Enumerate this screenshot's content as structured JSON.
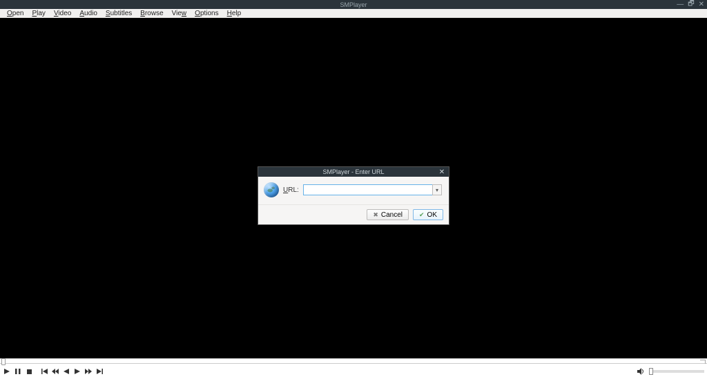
{
  "window": {
    "title": "SMPlayer"
  },
  "menu": {
    "items": [
      {
        "label": "Open",
        "mnemonic_index": 0
      },
      {
        "label": "Play",
        "mnemonic_index": 0
      },
      {
        "label": "Video",
        "mnemonic_index": 0
      },
      {
        "label": "Audio",
        "mnemonic_index": 0
      },
      {
        "label": "Subtitles",
        "mnemonic_index": 0
      },
      {
        "label": "Browse",
        "mnemonic_index": 0
      },
      {
        "label": "View",
        "mnemonic_index": 3
      },
      {
        "label": "Options",
        "mnemonic_index": 0
      },
      {
        "label": "Help",
        "mnemonic_index": 0
      }
    ]
  },
  "controls": {
    "play": "play",
    "pause": "pause",
    "stop": "stop",
    "prev": "previous",
    "rw": "rewind",
    "fw": "forward",
    "next": "next",
    "mute": "mute"
  },
  "dialog": {
    "title": "SMPlayer - Enter URL",
    "url_label": "URL:",
    "url_value": "",
    "cancel": "Cancel",
    "ok": "OK"
  }
}
